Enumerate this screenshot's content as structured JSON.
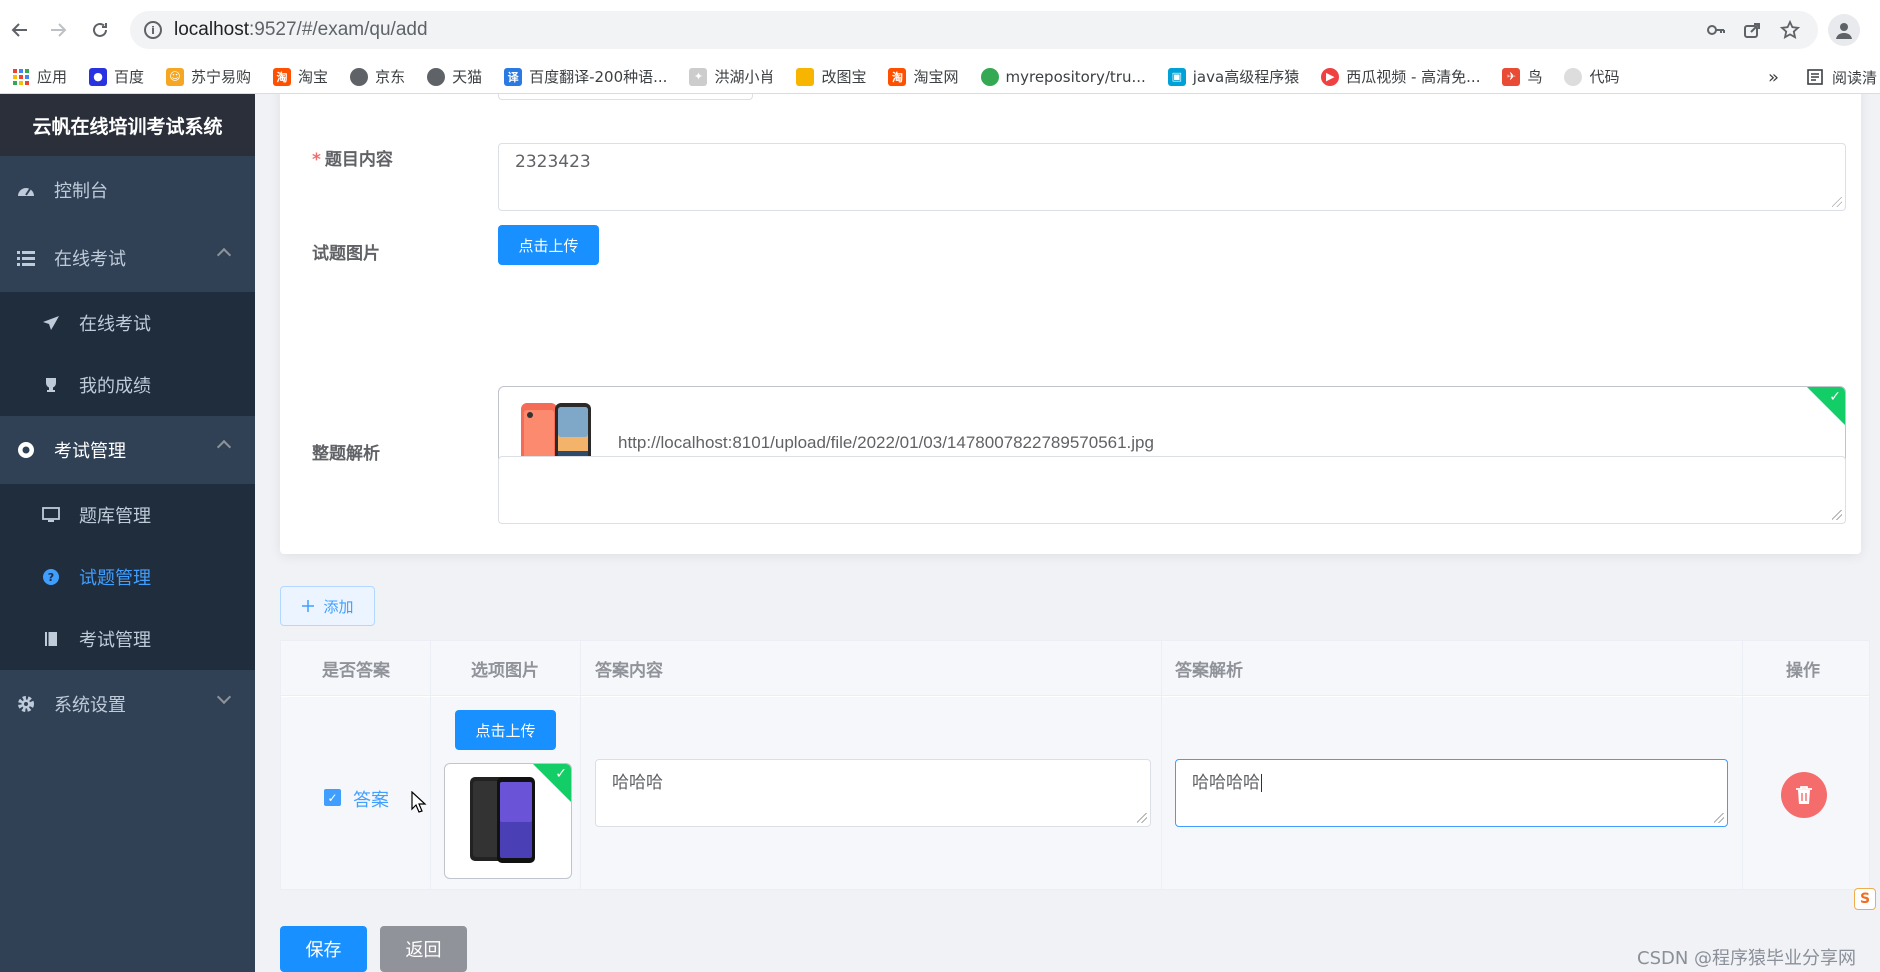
{
  "browser": {
    "url_host": "localhost",
    "url_rest": ":9527/#/exam/qu/add",
    "bookmarks": [
      {
        "label": "应用",
        "color": "#ea4335"
      },
      {
        "label": "百度",
        "color": "#2932e1"
      },
      {
        "label": "苏宁易购",
        "color": "#f5a623"
      },
      {
        "label": "淘宝",
        "color": "#ff5000"
      },
      {
        "label": "京东",
        "color": "#5f6368"
      },
      {
        "label": "天猫",
        "color": "#5f6368"
      },
      {
        "label": "百度翻译-200种语...",
        "color": "#2a7ae2"
      },
      {
        "label": "洪湖小肖",
        "color": "#888888"
      },
      {
        "label": "改图宝",
        "color": "#f7b500"
      },
      {
        "label": "淘宝网",
        "color": "#ff5000"
      },
      {
        "label": "myrepository/tru...",
        "color": "#34a853"
      },
      {
        "label": "java高级程序猿",
        "color": "#00a1d6"
      },
      {
        "label": "西瓜视频 - 高清免...",
        "color": "#f04142"
      },
      {
        "label": "鸟",
        "color": "#e94b35"
      },
      {
        "label": "代码",
        "color": "#dddddd"
      }
    ],
    "more": "»",
    "reading_list": "阅读清"
  },
  "sidebar": {
    "title": "云帆在线培训考试系统",
    "menu": {
      "dashboard": "控制台",
      "online_exam": "在线考试",
      "online_exam_sub": "在线考试",
      "my_scores": "我的成绩",
      "exam_mgmt": "考试管理",
      "bank_mgmt": "题库管理",
      "question_mgmt": "试题管理",
      "exam_mgmt_sub": "考试管理",
      "system_settings": "系统设置"
    }
  },
  "form": {
    "content_label": "题目内容",
    "content_value": "2323423",
    "image_label": "试题图片",
    "upload_label": "点击上传",
    "uploaded_url": "http://localhost:8101/upload/file/2022/01/03/1478007822789570561.jpg",
    "analysis_label": "整题解析",
    "analysis_value": ""
  },
  "options": {
    "add_label": "添加",
    "headers": {
      "is_answer": "是否答案",
      "image": "选项图片",
      "content": "答案内容",
      "analysis": "答案解析",
      "actions": "操作"
    },
    "rows": [
      {
        "answer_label": "答案",
        "is_answer": true,
        "upload_label": "点击上传",
        "content": "哈哈哈",
        "analysis": "哈哈哈哈"
      }
    ]
  },
  "actions": {
    "save": "保存",
    "back": "返回"
  },
  "watermark": "CSDN @程序猿毕业分享网",
  "colors": {
    "primary": "#1890ff",
    "sidebar_bg": "#304156",
    "active": "#409eff",
    "danger": "#f56c6c",
    "success": "#13ce66"
  }
}
